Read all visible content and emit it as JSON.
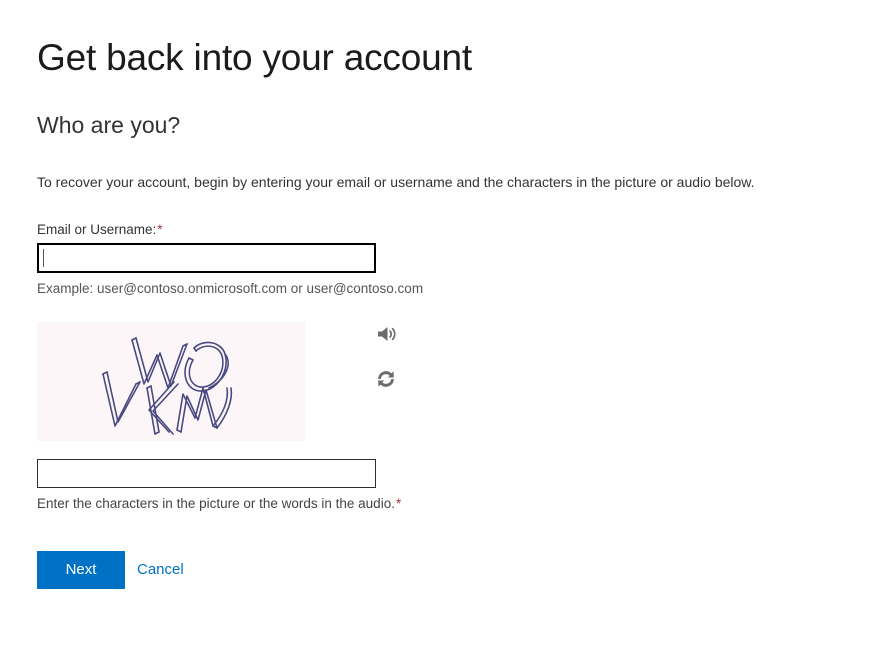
{
  "page": {
    "title": "Get back into your account",
    "subtitle": "Who are you?",
    "intro": "To recover your account, begin by entering your email or username and the characters in the picture or audio below."
  },
  "email_field": {
    "label": "Email or Username:",
    "required_marker": "*",
    "value": "",
    "placeholder": "",
    "focused": true,
    "hint": "Example: user@contoso.onmicrosoft.com or user@contoso.com"
  },
  "captcha": {
    "image_alt": "captcha-challenge-image",
    "characters_shown": "WO VKM",
    "background_color": "#fdf6f8",
    "stroke_color": "#4a4a82",
    "audio_button_name": "speaker-icon",
    "refresh_button_name": "refresh-icon"
  },
  "captcha_field": {
    "value": "",
    "placeholder": "",
    "hint": "Enter the characters in the picture or the words in the audio.",
    "required_marker": "*"
  },
  "actions": {
    "next_label": "Next",
    "cancel_label": "Cancel",
    "accent_color": "#0072c6",
    "required_color": "#a4373a"
  }
}
